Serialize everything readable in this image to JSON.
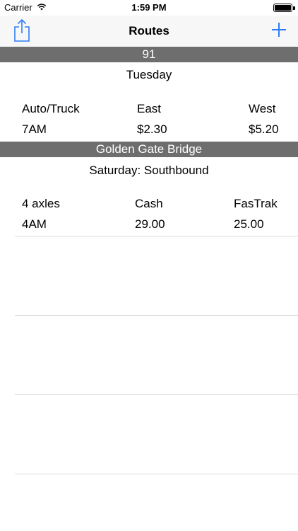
{
  "status_bar": {
    "carrier": "Carrier",
    "time": "1:59 PM"
  },
  "nav": {
    "title": "Routes",
    "left_icon": "share-icon",
    "right_icon": "plus-icon",
    "accent_color": "#2f7cf6"
  },
  "sections": [
    {
      "header": "91",
      "subtitle": "Tuesday",
      "columns": [
        "Auto/Truck",
        "East",
        "West"
      ],
      "row": [
        "7AM",
        "$2.30",
        "$5.20"
      ]
    },
    {
      "header": "Golden Gate Bridge",
      "subtitle": "Saturday: Southbound",
      "columns": [
        "4 axles",
        "Cash",
        "FasTrak"
      ],
      "row": [
        "4AM",
        "29.00",
        "25.00"
      ]
    }
  ],
  "colors": {
    "section_header_bg": "#6e6e6e",
    "nav_bg": "#f7f7f8",
    "separator": "#dcdcdc"
  }
}
